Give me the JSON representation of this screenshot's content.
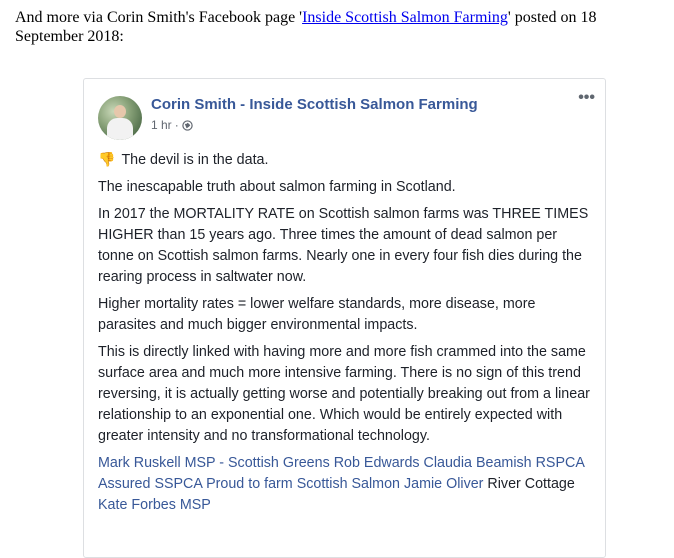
{
  "intro": {
    "before_link": "And more via Corin Smith's Facebook page '",
    "link": "Inside Scottish Salmon Farming",
    "after_link": "' posted on 18 September 2018:"
  },
  "post": {
    "author": "Corin Smith - Inside Scottish Salmon Farming",
    "time": "1 hr",
    "separator": "·",
    "more_label": "•••",
    "emoji": "👎",
    "paragraphs": [
      "The devil is in the data.",
      "The inescapable truth about salmon farming in Scotland.",
      "In 2017 the MORTALITY RATE on Scottish salmon farms was THREE TIMES HIGHER than 15 years ago. Three times the amount of dead salmon per tonne on Scottish salmon farms. Nearly one in every four fish dies during the rearing process in saltwater now.",
      "Higher mortality rates = lower welfare standards, more disease, more parasites and much bigger environmental impacts.",
      "This is directly linked with having more and more fish crammed into the same surface area and much more intensive farming. There is no sign of this trend reversing, it is actually getting worse and potentially breaking out from a linear relationship to an exponential one. Which would be entirely expected with greater intensity and no transformational technology."
    ],
    "tags": {
      "t1": "Mark Ruskell MSP - Scottish Greens",
      "t2": "Rob Edwards",
      "t3": "Claudia Beamish",
      "t4": "RSPCA Assured",
      "t5": "SSPCA",
      "t6": "Proud to farm Scottish Salmon",
      "t7": "Jamie Oliver",
      "t8": "River Cottage",
      "t9": "Kate Forbes MSP"
    }
  },
  "colors": {
    "link": "#0000ee",
    "fb_blue": "#385898",
    "text": "#1d2129",
    "meta": "#616770"
  },
  "icons": {
    "globe": "globe-icon",
    "more": "more-options-icon",
    "emoji": "thumbs-down-icon"
  }
}
